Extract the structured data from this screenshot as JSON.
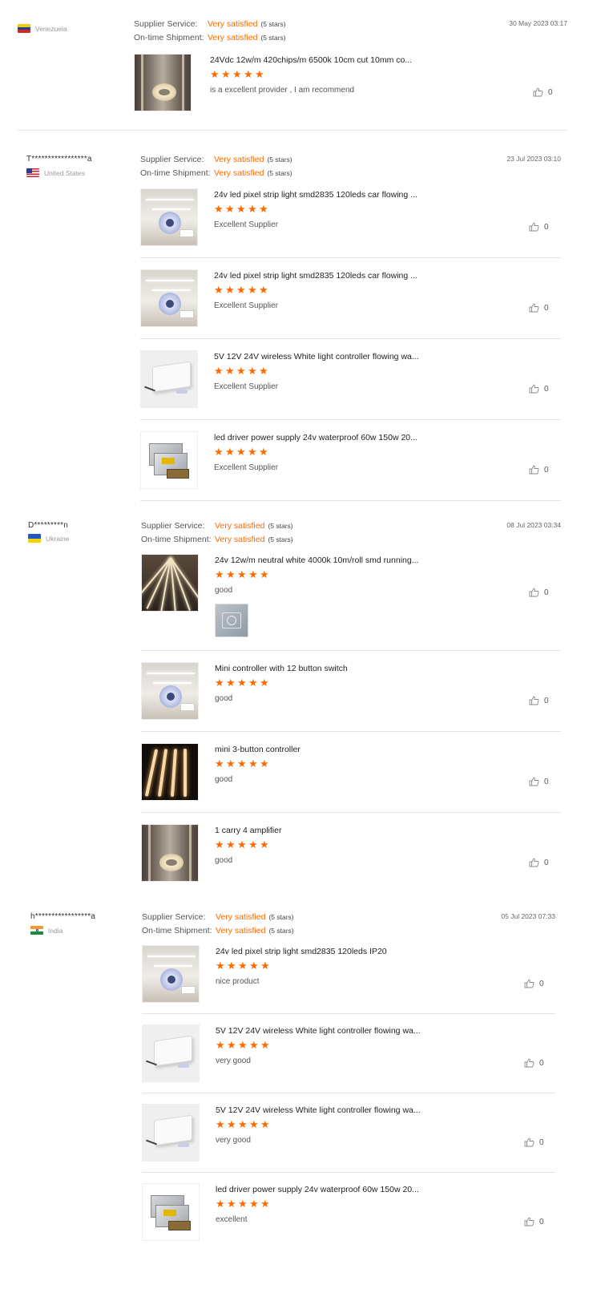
{
  "colors": {
    "accent": "#ff6a00",
    "separator": "#e3e3e3"
  },
  "labels": {
    "supplier_service": "Supplier Service:",
    "ontime_shipment": "On-time Shipment:"
  },
  "reviews": [
    {
      "name": "",
      "country": "Venezuela",
      "supplier_service": "Very satisfied",
      "supplier_service_stars": "(5 stars)",
      "ontime_shipment": "Very satisfied",
      "ontime_shipment_stars": "(5 stars)",
      "date": "30 May 2023 03:17",
      "items": [
        {
          "title": "24Vdc 12w/m 420chips/m 6500k 10cm cut 10mm co...",
          "rating": 5,
          "comment": "is a excellent provider , I am recommend",
          "likes": "0",
          "thumb_icon": "corridor-light-icon"
        }
      ]
    },
    {
      "name": "T*****************a",
      "country": "United States",
      "supplier_service": "Very satisfied",
      "supplier_service_stars": "(5 stars)",
      "ontime_shipment": "Very satisfied",
      "ontime_shipment_stars": "(5 stars)",
      "date": "23 Jul 2023 03:10",
      "items": [
        {
          "title": "24v led pixel strip light smd2835 120leds car flowing ...",
          "rating": 5,
          "comment": "Excellent Supplier",
          "likes": "0",
          "thumb_icon": "strip-reel-icon"
        },
        {
          "title": "24v led pixel strip light smd2835 120leds car flowing ...",
          "rating": 5,
          "comment": "Excellent Supplier",
          "likes": "0",
          "thumb_icon": "strip-reel-icon"
        },
        {
          "title": "5V 12V 24V wireless White light controller flowing wa...",
          "rating": 5,
          "comment": "Excellent Supplier",
          "likes": "0",
          "thumb_icon": "controller-box-icon"
        },
        {
          "title": "led driver power supply 24v waterproof 60w 150w 20...",
          "rating": 5,
          "comment": "Excellent Supplier",
          "likes": "0",
          "thumb_icon": "power-supply-icon"
        }
      ]
    },
    {
      "name": "D*********n",
      "country": "Ukraine",
      "supplier_service": "Very satisfied",
      "supplier_service_stars": "(5 stars)",
      "ontime_shipment": "Very satisfied",
      "ontime_shipment_stars": "(5 stars)",
      "date": "08 Jul 2023 03:34",
      "items": [
        {
          "title": "24v 12w/m neutral white 4000k 10m/roll smd running...",
          "rating": 5,
          "comment": "good",
          "likes": "0",
          "thumb_icon": "light-rays-icon",
          "has_photo": true
        },
        {
          "title": "Mini controller with 12 button switch",
          "rating": 5,
          "comment": "good",
          "likes": "0",
          "thumb_icon": "strip-reel-icon"
        },
        {
          "title": "mini 3-button controller",
          "rating": 5,
          "comment": "good",
          "likes": "0",
          "thumb_icon": "neon-strip-icon"
        },
        {
          "title": "1 carry 4 amplifier",
          "rating": 5,
          "comment": "good",
          "likes": "0",
          "thumb_icon": "corridor-light-icon"
        }
      ]
    },
    {
      "name": "h*****************a",
      "country": "India",
      "supplier_service": "Very satisfied",
      "supplier_service_stars": "(5 stars)",
      "ontime_shipment": "Very satisfied",
      "ontime_shipment_stars": "(5 stars)",
      "date": "05 Jul 2023 07:33",
      "items": [
        {
          "title": "24v led pixel strip light smd2835 120leds IP20",
          "rating": 5,
          "comment": "nice product",
          "likes": "0",
          "thumb_icon": "strip-reel-icon"
        },
        {
          "title": "5V 12V 24V wireless White light controller flowing wa...",
          "rating": 5,
          "comment": "very good",
          "likes": "0",
          "thumb_icon": "controller-box-icon"
        },
        {
          "title": "5V 12V 24V wireless White light controller flowing wa...",
          "rating": 5,
          "comment": "very good",
          "likes": "0",
          "thumb_icon": "controller-box-icon"
        },
        {
          "title": "led driver power supply 24v waterproof 60w 150w 20...",
          "rating": 5,
          "comment": "excellent",
          "likes": "0",
          "thumb_icon": "power-supply-icon"
        }
      ]
    }
  ]
}
